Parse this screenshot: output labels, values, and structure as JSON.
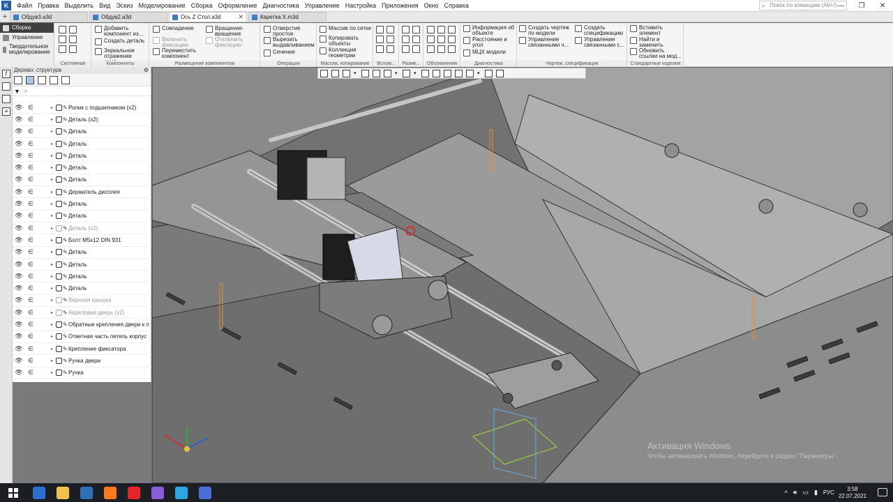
{
  "app": {
    "menu": [
      "Файл",
      "Правка",
      "Выделить",
      "Вид",
      "Эскиз",
      "Моделирование",
      "Сборка",
      "Оформление",
      "Диагностика",
      "Управление",
      "Настройка",
      "Приложения",
      "Окно",
      "Справка"
    ],
    "command_search_placeholder": "Поиск по командам (Alt+/)"
  },
  "tabs": [
    {
      "label": "Обдув3.a3d",
      "active": false
    },
    {
      "label": "Обдув2.a3d",
      "active": false
    },
    {
      "label": "Ось Z Стол.a3d",
      "active": true
    },
    {
      "label": "Каретка X.m3d",
      "active": false
    }
  ],
  "ribbon": {
    "modes": [
      "Сборка",
      "Управление",
      "Твердотельное моделирование"
    ],
    "groups": {
      "system": "Системная",
      "components": "Компоненты",
      "placement": "Размещение компонентов",
      "operations": "Операции",
      "arrays": "Массив, копирование",
      "aux": "Вспом...",
      "dims": "Разме...",
      "notations": "Обозначения",
      "diagnostics": "Диагностика",
      "drawing": "Чертеж, спецификация",
      "standard": "Стандартные изделия"
    },
    "buttons": {
      "add_component": "Добавить компонент из...",
      "create_detail": "Создать деталь",
      "mirror_component": "Зеркальное отражение комп...",
      "coincidence": "Совпадение",
      "enable_fix": "Включить фиксацию",
      "move_component": "Переместить компонент",
      "rotation": "Вращение-вращение",
      "disable_fix": "Отключить фиксацию",
      "hole_simple": "Отверстие простое",
      "cut_extrude": "Вырезать выдавливанием",
      "section": "Сечение",
      "grid_array": "Массив по сетке",
      "copy_objects": "Копировать объекты",
      "geometry_collection": "Коллекция геометрии",
      "object_info": "Информация об объекте",
      "distance_angle": "Расстояние и угол",
      "mass_properties": "МЦХ модели",
      "create_drawing": "Создать чертеж по модели",
      "manage_linked": "Управление связанными ч...",
      "create_spec": "Создать спецификацию",
      "manage_linked_spec": "Управление связанными с...",
      "insert_element": "Вставить элемент",
      "find_replace": "Найти и заменить",
      "update_refs": "Обновить ссылки на мод..."
    }
  },
  "tree": {
    "title": "Дерево: структура",
    "items": [
      {
        "label": "Ролик с подшипником (x2)",
        "dim": false
      },
      {
        "label": "Деталь (x2)",
        "dim": false
      },
      {
        "label": "Деталь",
        "dim": false
      },
      {
        "label": "Деталь",
        "dim": false
      },
      {
        "label": "Деталь",
        "dim": false
      },
      {
        "label": "Деталь",
        "dim": false
      },
      {
        "label": "Деталь",
        "dim": false
      },
      {
        "label": "Держатель дисплея",
        "dim": false
      },
      {
        "label": "Деталь",
        "dim": false
      },
      {
        "label": "Деталь",
        "dim": false
      },
      {
        "label": "Деталь (x2)",
        "dim": true
      },
      {
        "label": "Болт М5х12 DIN 931",
        "dim": false
      },
      {
        "label": "Деталь",
        "dim": false
      },
      {
        "label": "Деталь",
        "dim": false
      },
      {
        "label": "Деталь",
        "dim": false
      },
      {
        "label": "Деталь",
        "dim": false
      },
      {
        "label": "Верхняя крышка",
        "dim": true
      },
      {
        "label": "Акриловая дверь (x2)",
        "dim": true
      },
      {
        "label": "Обратные крепления двери к п",
        "dim": false
      },
      {
        "label": "Ответная часть петель корпус",
        "dim": false
      },
      {
        "label": "Крепление фиксатора",
        "dim": false
      },
      {
        "label": "Ручка двери",
        "dim": false
      },
      {
        "label": "Ручка",
        "dim": false
      }
    ]
  },
  "watermark": {
    "title": "Активация Windows",
    "subtitle": "Чтобы активировать Windows, перейдите в раздел \"Параметры\"."
  },
  "taskbar": {
    "language": "РУС",
    "time": "3:58",
    "date": "22.07.2021",
    "app_colors": [
      "#2d6fd1",
      "#f0c14b",
      "#2f6fb5",
      "#ff7a1a",
      "#e2252b",
      "#8a5cd8",
      "#2ca5e0",
      "#4a6fd8"
    ]
  }
}
